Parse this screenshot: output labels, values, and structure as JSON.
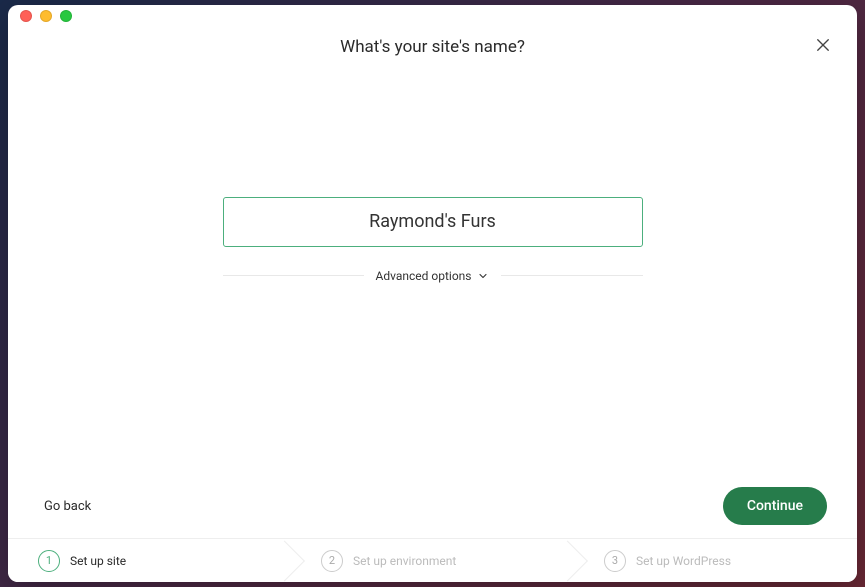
{
  "header": {
    "title": "What's your site's name?"
  },
  "form": {
    "site_name": "Raymond's Furs",
    "advanced_label": "Advanced options"
  },
  "footer": {
    "back_label": "Go back",
    "continue_label": "Continue"
  },
  "stepper": {
    "steps": [
      {
        "num": "1",
        "label": "Set up site",
        "active": true
      },
      {
        "num": "2",
        "label": "Set up environment",
        "active": false
      },
      {
        "num": "3",
        "label": "Set up WordPress",
        "active": false
      }
    ]
  }
}
